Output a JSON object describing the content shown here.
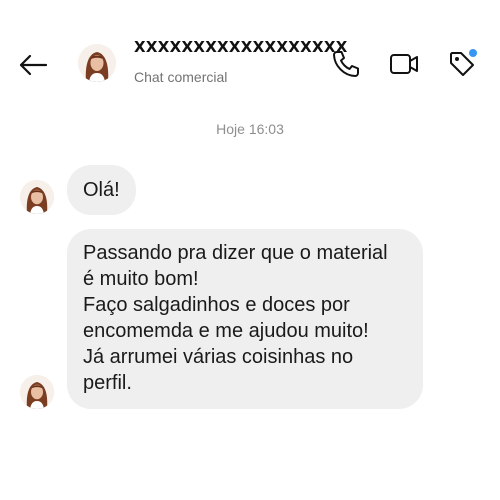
{
  "header": {
    "contact_name": "XXXXXXXXXXXXXXXXXX",
    "subtitle": "Chat comercial",
    "icons": [
      "arrow-left-icon",
      "phone-icon",
      "video-icon",
      "tag-icon"
    ],
    "notification_dot_color": "#3897f0"
  },
  "conversation": {
    "timestamp": "Hoje 16:03",
    "messages": [
      {
        "lines": [
          "Olá!"
        ]
      },
      {
        "lines": [
          "Passando pra dizer que o material",
          "é muito bom!",
          "Faço salgadinhos e doces por",
          "encomemda e me ajudou muito!",
          "Já arrumei várias coisinhas no",
          "perfil."
        ]
      }
    ]
  },
  "colors": {
    "bubble_background": "#efefef",
    "secondary_text": "#8e8e8e"
  }
}
